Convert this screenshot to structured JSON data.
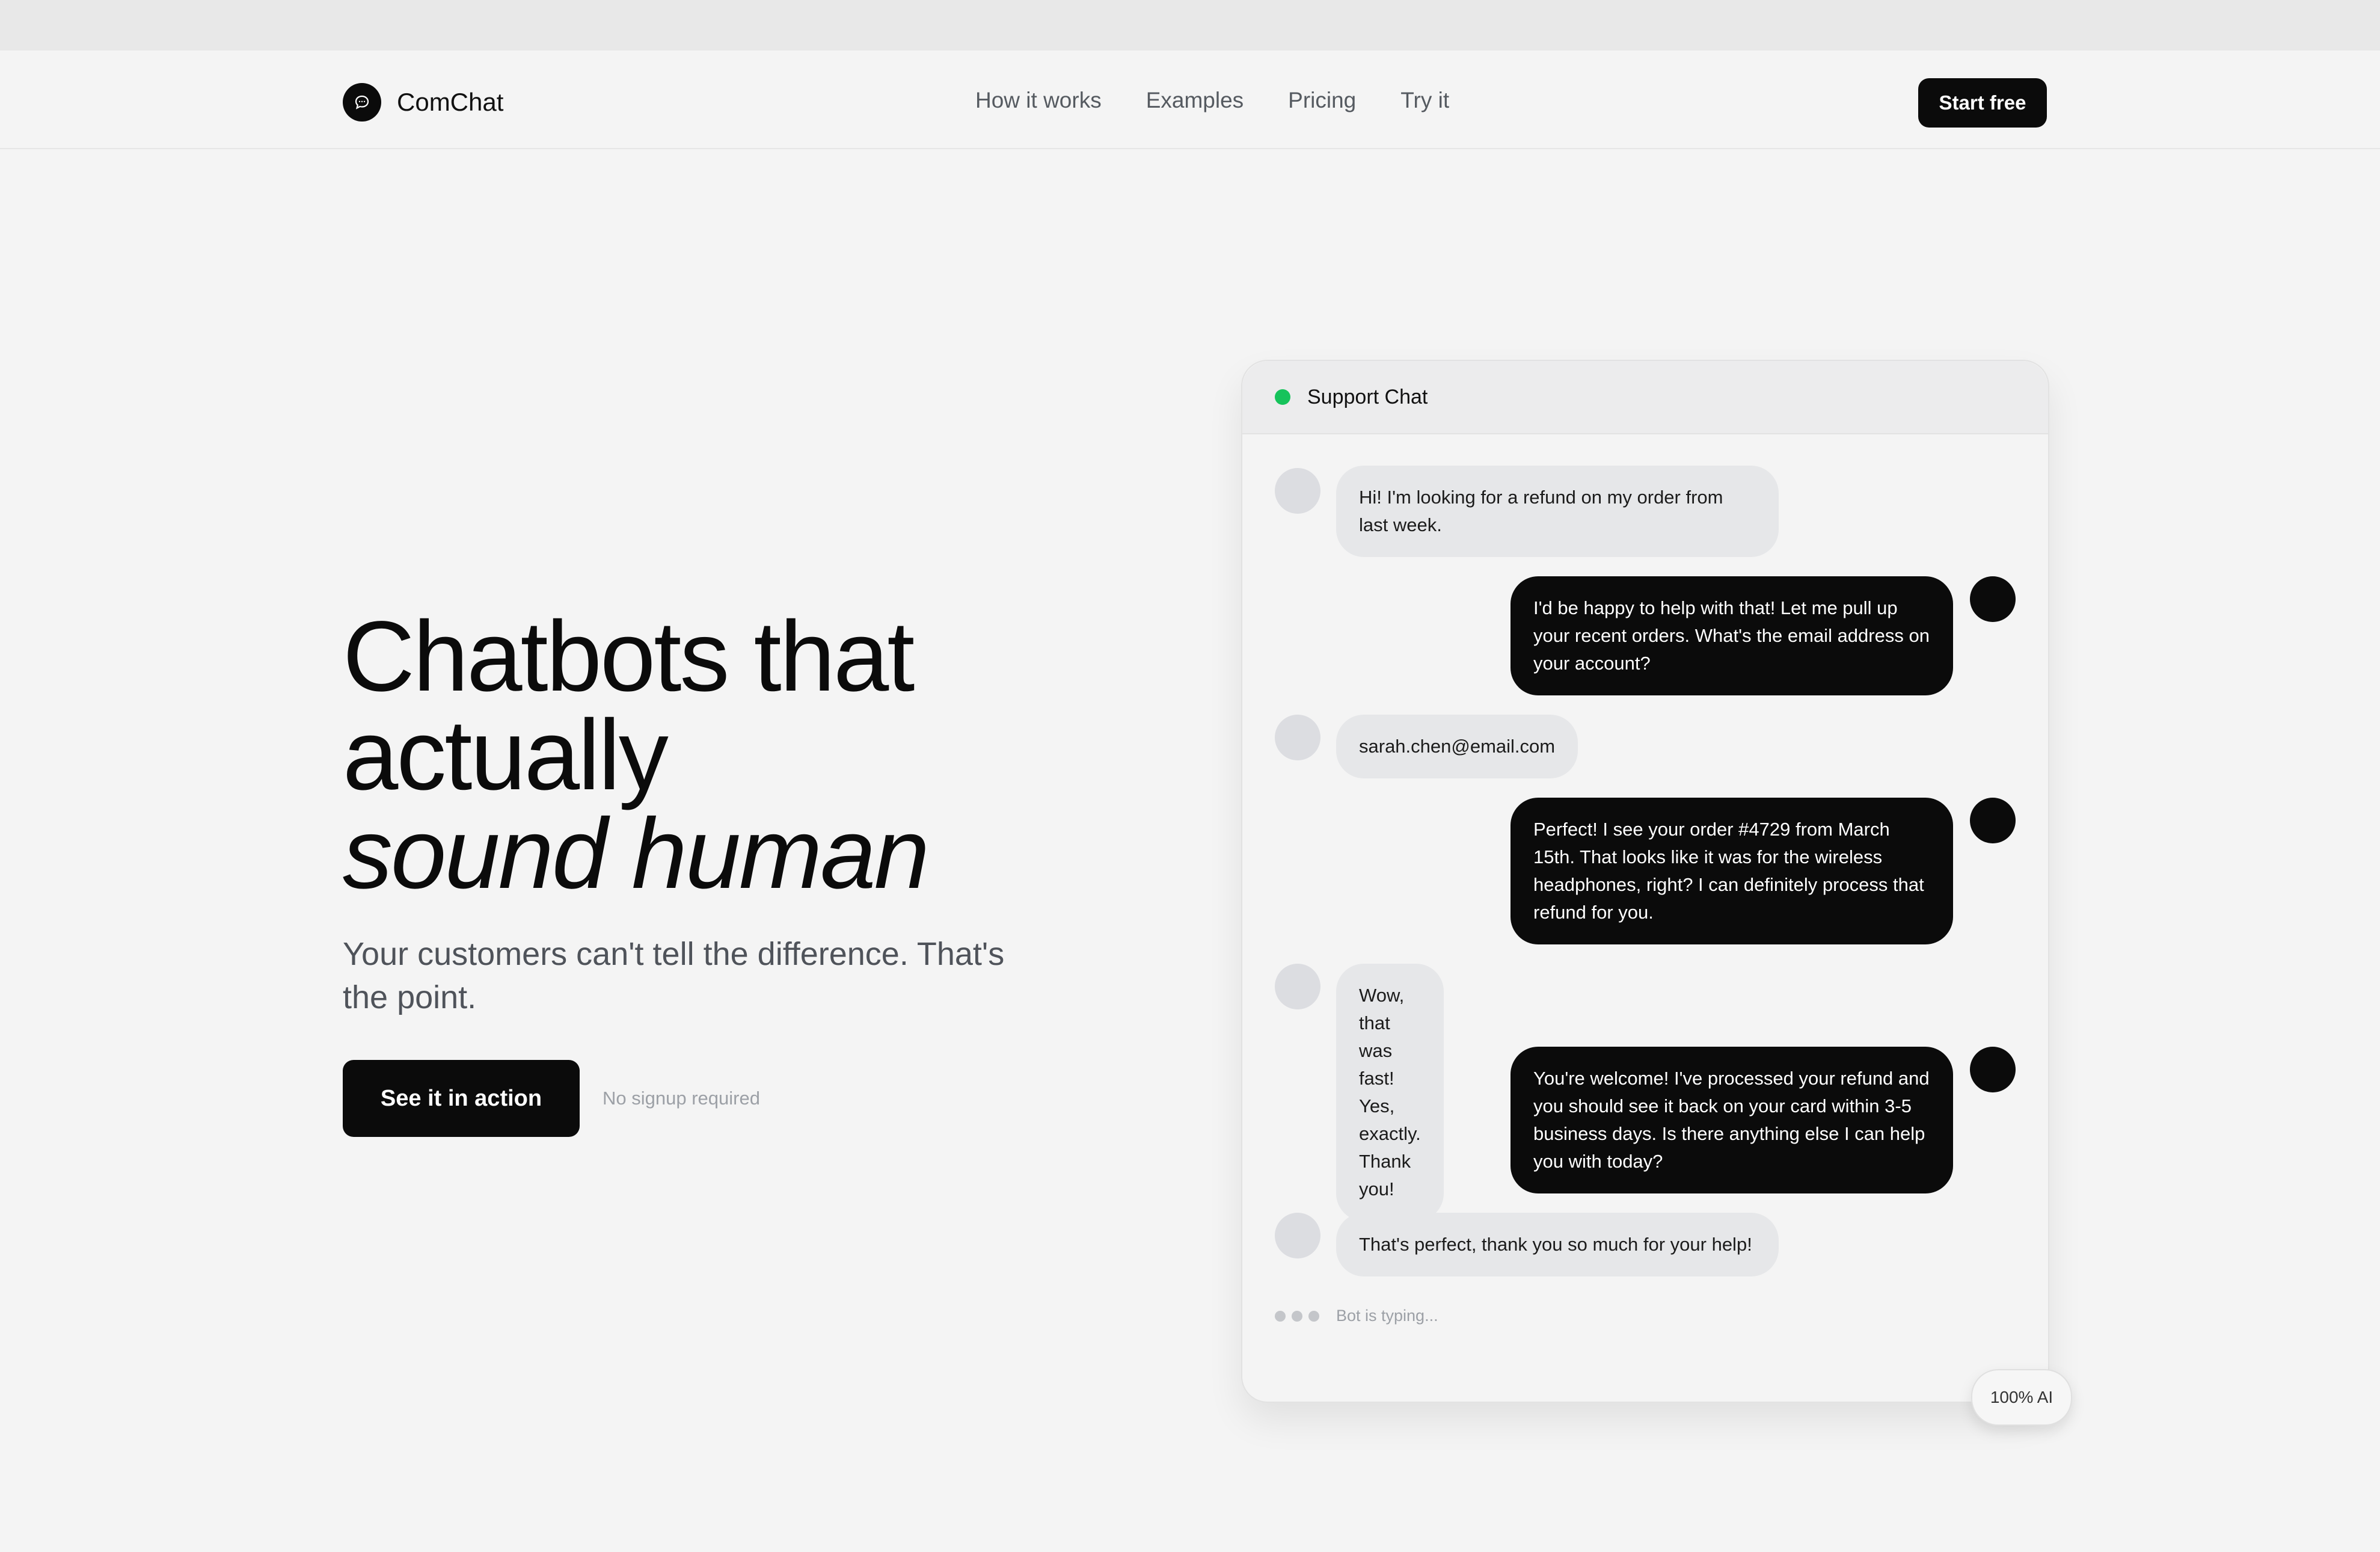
{
  "nav": {
    "brand": "ComChat",
    "links": [
      "How it works",
      "Examples",
      "Pricing",
      "Try it"
    ],
    "cta": "Start free"
  },
  "hero": {
    "headline_line1": "Chatbots that",
    "headline_line2": "actually",
    "headline_line3": "sound human",
    "subhead": "Your customers can't tell the difference. That's the point.",
    "primary_button": "See it in action",
    "note": "No signup required"
  },
  "chat": {
    "title": "Support Chat",
    "status_color": "#16c35b",
    "messages": [
      {
        "from": "user",
        "text": "Hi! I'm looking for a refund on my order from last week."
      },
      {
        "from": "bot",
        "text": "I'd be happy to help with that! Let me pull up your recent orders. What's the email address on your account?"
      },
      {
        "from": "user",
        "text": "sarah.chen@email.com"
      },
      {
        "from": "bot",
        "text": "Perfect! I see your order #4729 from March 15th. That looks like it was for the wireless headphones, right? I can definitely process that refund for you."
      },
      {
        "from": "user",
        "text": "Wow, that was fast! Yes, exactly. Thank you!"
      },
      {
        "from": "bot",
        "text": "You're welcome! I've processed your refund and you should see it back on your card within 3-5 business days. Is there anything else I can help you with today?"
      },
      {
        "from": "user",
        "text": "That's perfect, thank you so much for your help!"
      }
    ],
    "typing_text": "Bot is typing...",
    "badge": "100% AI"
  },
  "colors": {
    "background": "#f4f4f4",
    "primary": "#0b0b0b",
    "user_bubble": "#e6e7e9",
    "muted_text": "#9ca0a6"
  }
}
